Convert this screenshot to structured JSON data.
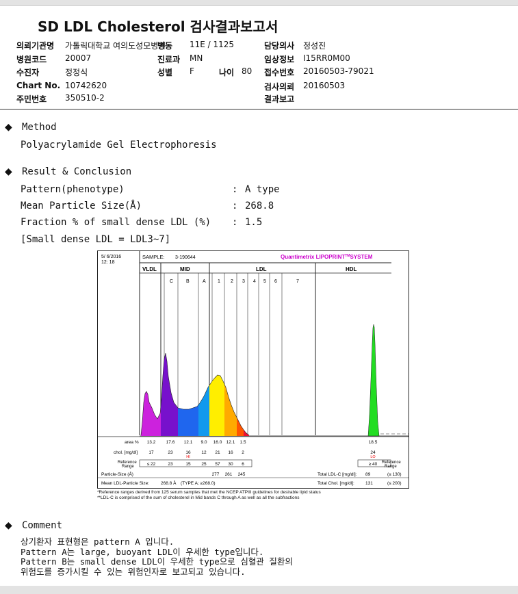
{
  "title": "SD LDL Cholesterol 검사결과보고서",
  "info": {
    "hospital_label": "의뢰기관명",
    "hospital_value": "가톨릭대학교 여의도성모병원",
    "ward_label": "병동",
    "ward_value": "11E / 1125",
    "doctor_label": "담당의사",
    "doctor_value": "정성진",
    "code_label": "병원코드",
    "code_value": "20007",
    "dept_label": "진료과",
    "dept_value": "MN",
    "clinical_label": "임상정보",
    "clinical_value": "I15RR0M00",
    "patient_label": "수진자",
    "patient_value": "정정식",
    "sex_label": "성별",
    "sex_value": "F",
    "age_label": "나이",
    "age_value": "80",
    "receipt_label": "접수번호",
    "receipt_value": "20160503-79021",
    "chart_label": "Chart No.",
    "chart_value": "10742620",
    "request_label": "검사의뢰",
    "request_value": "20160503",
    "id_label": "주민번호",
    "id_value": "350510-2",
    "report_label": "결과보고",
    "report_value": ""
  },
  "method": {
    "bullet": "◆",
    "heading": "Method",
    "text": "Polyacrylamide Gel Electrophoresis"
  },
  "result": {
    "bullet": "◆",
    "heading": "Result & Conclusion",
    "rows": [
      {
        "label": "Pattern(phenotype)",
        "colon": ":",
        "value": "A type"
      },
      {
        "label": "Mean Particle Size(Å)",
        "colon": ":",
        "value": "268.8"
      },
      {
        "label": "Fraction % of small dense LDL (%)",
        "colon": ":",
        "value": "1.5"
      }
    ],
    "note": "[Small dense LDL = LDL3~7]"
  },
  "lipoprint": {
    "date": "5/ 6/2016",
    "time": "12: 18",
    "sample_label": "SAMPLE:",
    "sample_value": "3-190644",
    "brand": "Quantimetrix LIPOPRINT",
    "brand_tm": "TM",
    "brand_system": "SYSTEM",
    "group_vldl": "VLDL",
    "group_mid": "MID",
    "group_ldl": "LDL",
    "group_hdl": "HDL",
    "bands": [
      "C",
      "B",
      "A",
      "1",
      "2",
      "3",
      "4",
      "5",
      "6",
      "7"
    ],
    "colors": {
      "vldl": "#cc22dd",
      "c": "#7711cc",
      "b": "#1f66ee",
      "a": "#1199ee",
      "ldl1": "#ffee00",
      "ldl2": "#ffaa00",
      "ldl3": "#ff5500",
      "ldl4": "#ee1133",
      "hdl": "#22dd22",
      "brand": "#cc00cc",
      "hi_lo": "#ee0000"
    },
    "row_area_label": "area %",
    "area": [
      "13.2",
      "17.6",
      "12.1",
      "9.0",
      "16.0",
      "12.1",
      "1.5"
    ],
    "area_hdl": "18.5",
    "row_chol_label": "chol. [mg/dl]",
    "chol": [
      "17",
      "23",
      "16",
      "12",
      "21",
      "16",
      "2"
    ],
    "chol_hdl": "24",
    "hi": "HI",
    "lo": "LO",
    "row_ref_label": "Reference Range",
    "ref": [
      "≤ 22",
      "23",
      "15",
      "25",
      "57",
      "30",
      "6"
    ],
    "ref_hdl": "≥ 40",
    "ref_right_label": "Reference Range",
    "particle_label": "Particle-Size (Å)",
    "particle": [
      "277",
      "261",
      "245"
    ],
    "mean_label": "Mean LDL-Particle Size:",
    "mean_value": "268.8 Å",
    "mean_type": "(TYPE A; ≥268.0)",
    "total_ldl_label": "Total LDL-C [mg/dl]:",
    "total_ldl_value": "89",
    "total_ldl_ref": "(≤ 130)",
    "total_chol_label": "Total Chol. [mg/dl]:",
    "total_chol_value": "131",
    "total_chol_ref": "(≤ 200)",
    "footnote1": "*Reference ranges derived from 125 serum samples that met the NCEP ATPIII guidelines for desirable lipid status",
    "footnote2": "**LDL-C is comprised of the sum of cholesterol in Mid bands C through A as well as all the subfractions"
  },
  "comment": {
    "bullet": "◆",
    "heading": "Comment",
    "lines": [
      "상기환자 표현형은 pattern A 입니다.",
      "Pattern A는 large, buoyant LDL이 우세한 type입니다.",
      "Pattern B는 small dense LDL이 우세한 type으로 심혈관 질환의",
      "위험도를 증가시킬 수 있는 위험인자로 보고되고 있습니다."
    ]
  }
}
